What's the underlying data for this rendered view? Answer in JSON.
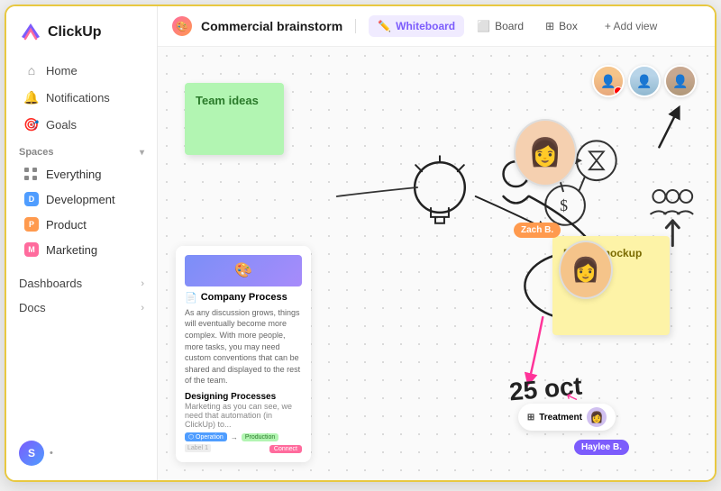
{
  "app": {
    "name": "ClickUp"
  },
  "sidebar": {
    "nav": [
      {
        "id": "home",
        "label": "Home",
        "icon": "⌂"
      },
      {
        "id": "notifications",
        "label": "Notifications",
        "icon": "🔔"
      },
      {
        "id": "goals",
        "label": "Goals",
        "icon": "🎯"
      }
    ],
    "spaces_label": "Spaces",
    "spaces": [
      {
        "id": "everything",
        "label": "Everything",
        "color": ""
      },
      {
        "id": "development",
        "label": "Development",
        "color": "#4f9dff",
        "letter": "D"
      },
      {
        "id": "product",
        "label": "Product",
        "color": "#ff9a4e",
        "letter": "P"
      },
      {
        "id": "marketing",
        "label": "Marketing",
        "color": "#ff6b9d",
        "letter": "M"
      }
    ],
    "bottom": [
      {
        "id": "dashboards",
        "label": "Dashboards"
      },
      {
        "id": "docs",
        "label": "Docs"
      }
    ],
    "user": {
      "initial": "S",
      "name": ""
    }
  },
  "header": {
    "page_icon": "🎨",
    "page_title": "Commercial brainstorm",
    "views": [
      {
        "id": "whiteboard",
        "label": "Whiteboard",
        "icon": "✏️",
        "active": true
      },
      {
        "id": "board",
        "label": "Board",
        "icon": "⬜"
      },
      {
        "id": "box",
        "label": "Box",
        "icon": "⊞"
      }
    ],
    "add_view_label": "+ Add view"
  },
  "canvas": {
    "sticky_green": {
      "text": "Team ideas"
    },
    "sticky_yellow": {
      "text": "Rough mockup"
    },
    "doc_card": {
      "icon": "📄",
      "title": "Company Process",
      "body_text": "As any discussion grows, things will eventually become more complex. With more people, more tasks, you may need custom conventions that can be shared and displayed to the rest of the team.",
      "section": "Designing Processes",
      "sub_text": "Marketing as you can see, we need that automation (in ClickUp) to..."
    },
    "date_text": "25 oct",
    "labels": {
      "zach": "Zach B.",
      "treatment": "Treatment",
      "haylee": "Haylee B."
    },
    "people_icons": "👥"
  }
}
